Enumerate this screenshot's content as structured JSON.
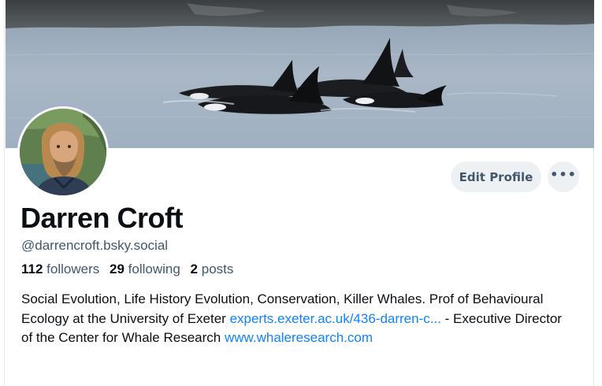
{
  "profile": {
    "display_name": "Darren Croft",
    "handle": "@darrencroft.bsky.social",
    "banner_icon": "killer-whales-photo",
    "avatar_icon": "profile-photo"
  },
  "actions": {
    "edit_profile_label": "Edit Profile",
    "more_label": "•••"
  },
  "stats": {
    "followers_count": "112",
    "followers_label": "followers",
    "following_count": "29",
    "following_label": "following",
    "posts_count": "2",
    "posts_label": "posts"
  },
  "bio": {
    "text_1": "Social Evolution, Life History Evolution, Conservation, Killer Whales. Prof of Behavioural Ecology at the University of Exeter ",
    "link_1": "experts.exeter.ac.uk/436-darren-c...",
    "text_2": " - Executive Director of the Center for Whale Research ",
    "link_2": "www.whaleresearch.com"
  },
  "colors": {
    "link": "#1083fe",
    "muted_text": "#42576c",
    "primary_text": "#0b0f14",
    "button_bg": "#eef1f4"
  }
}
